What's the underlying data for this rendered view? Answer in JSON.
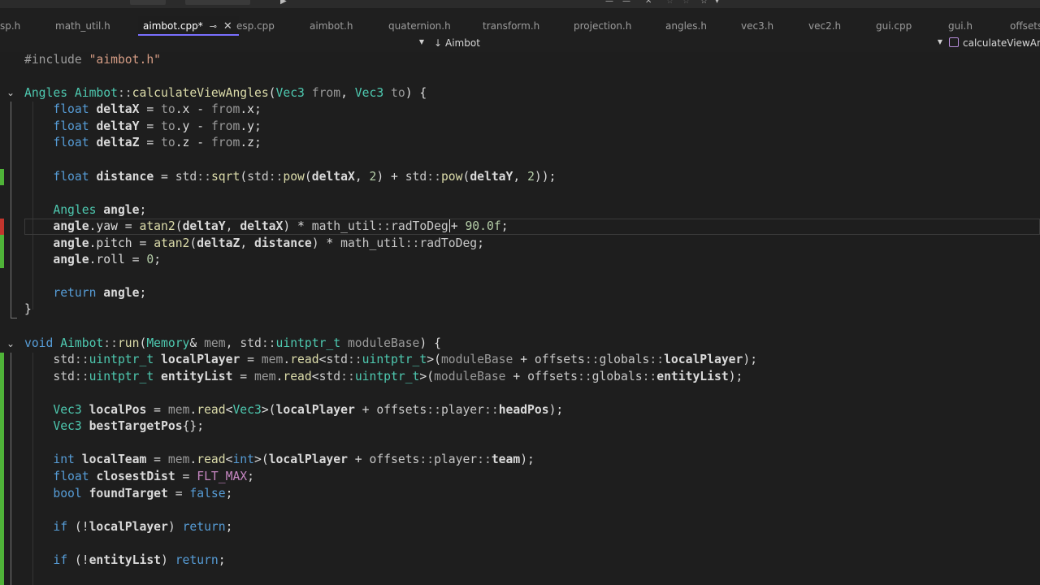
{
  "tabs": [
    {
      "label": "sp.h"
    },
    {
      "label": "math_util.h"
    },
    {
      "label": "aimbot.cpp*"
    },
    {
      "label": "esp.cpp"
    },
    {
      "label": "aimbot.h"
    },
    {
      "label": "quaternion.h"
    },
    {
      "label": "transform.h"
    },
    {
      "label": "projection.h"
    },
    {
      "label": "angles.h"
    },
    {
      "label": "vec3.h"
    },
    {
      "label": "vec2.h"
    },
    {
      "label": "gui.cpp"
    },
    {
      "label": "gui.h"
    },
    {
      "label": "offsets."
    }
  ],
  "active_tab_index": 2,
  "navbar": {
    "scope": "Aimbot",
    "member": "calculateViewAngles"
  },
  "code_lines": [
    "#include \"aimbot.h\"",
    "",
    "Angles Aimbot::calculateViewAngles(Vec3 from, Vec3 to) {",
    "    float deltaX = to.x - from.x;",
    "    float deltaY = to.y - from.y;",
    "    float deltaZ = to.z - from.z;",
    "",
    "    float distance = std::sqrt(std::pow(deltaX, 2) + std::pow(deltaY, 2));",
    "",
    "    Angles angle;",
    "    angle.yaw = atan2(deltaY, deltaX) * math_util::radToDeg + 90.0f;",
    "    angle.pitch = atan2(deltaZ, distance) * math_util::radToDeg;",
    "    angle.roll = 0;",
    "",
    "    return angle;",
    "}",
    "",
    "void Aimbot::run(Memory& mem, std::uintptr_t moduleBase) {",
    "    std::uintptr_t localPlayer = mem.read<std::uintptr_t>(moduleBase + offsets::globals::localPlayer);",
    "    std::uintptr_t entityList = mem.read<std::uintptr_t>(moduleBase + offsets::globals::entityList);",
    "",
    "    Vec3 localPos = mem.read<Vec3>(localPlayer + offsets::player::headPos);",
    "    Vec3 bestTargetPos{};",
    "",
    "    int localTeam = mem.read<int>(localPlayer + offsets::player::team);",
    "    float closestDist = FLT_MAX;",
    "    bool foundTarget = false;",
    "",
    "    if (!localPlayer) return;",
    "",
    "    if (!entityList) return;"
  ],
  "colors": {
    "keyword": "#569cd6",
    "type": "#4ec9b0",
    "function": "#dcdcaa",
    "number": "#b5cea8",
    "string": "#d69d85",
    "preprocessor": "#9b9b9b",
    "modified_gutter": "#4fb338",
    "unsaved_gutter": "#c2352d",
    "active_tab_underline": "#7a6fff"
  }
}
